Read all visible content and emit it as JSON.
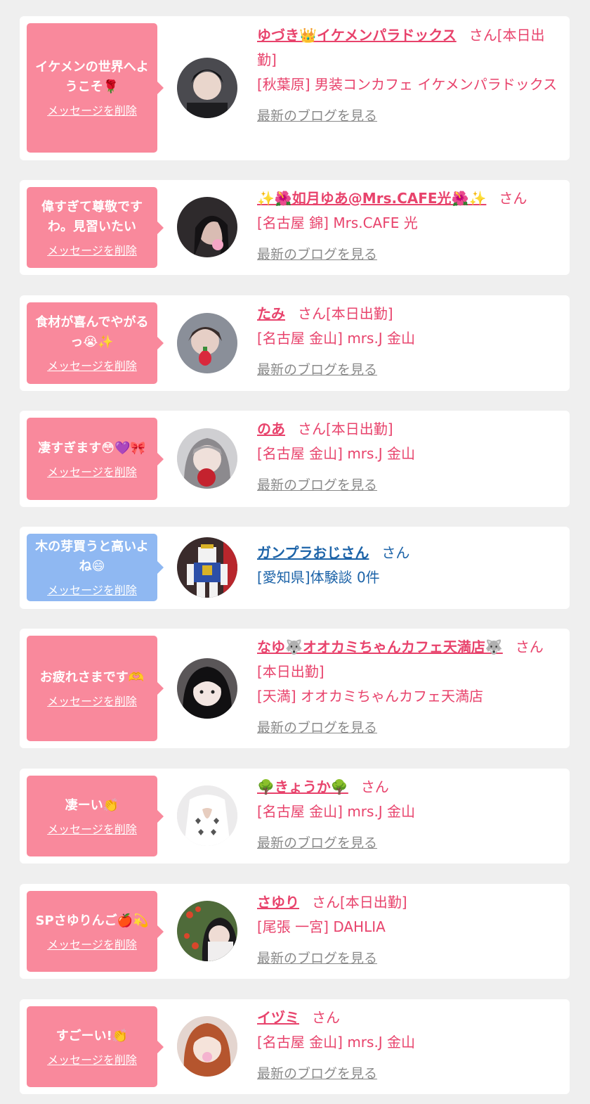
{
  "delete_label": "メッセージを削除",
  "blog_label": "最新のブログを見る",
  "san_label": "さん",
  "items": [
    {
      "message": "イケメンの世界へようこそ🌹",
      "name": "ゆづき👑イケメンパラドックス",
      "status": "[本日出勤]",
      "shop": "[秋葉原] 男装コンカフェ イケメンパラドックス",
      "theme": "pink",
      "avatar": "person-dark-hair"
    },
    {
      "message": "偉すぎて尊敬ですわ。見習いたい",
      "name": "✨🌺如月ゆあ@Mrs.CAFE光🌺✨",
      "status": "",
      "shop": "[名古屋 錦] Mrs.CAFE 光",
      "theme": "pink",
      "avatar": "person-dark"
    },
    {
      "message": "食材が喜んでやがるっ😭✨",
      "name": "たみ",
      "status": "[本日出勤]",
      "shop": "[名古屋 金山] mrs.J 金山",
      "theme": "pink",
      "avatar": "person-strawberry"
    },
    {
      "message": "凄すぎます😳💜🎀",
      "name": "のあ",
      "status": "[本日出勤]",
      "shop": "[名古屋 金山] mrs.J 金山",
      "theme": "pink",
      "avatar": "person-light-hair"
    },
    {
      "message": "木の芽買うと高いよね😄",
      "name": "ガンプラおじさん",
      "status": "",
      "shop": "[愛知県]体験談 0件",
      "theme": "blue",
      "avatar": "robot-model"
    },
    {
      "message": "お疲れさまです🫶",
      "name": "なゆ🐺オオカミちゃんカフェ天満店🐺",
      "status": "[本日出勤]",
      "shop": "[天満] オオカミちゃんカフェ天満店",
      "theme": "pink",
      "avatar": "person-bangs"
    },
    {
      "message": "凄ーい👏",
      "name": "🌳きょうか🌳",
      "status": "",
      "shop": "[名古屋 金山] mrs.J 金山",
      "theme": "pink",
      "avatar": "white-outfit"
    },
    {
      "message": "SPさゆりんご🍎💫",
      "name": "さゆり",
      "status": "[本日出勤]",
      "shop": "[尾張 一宮] DAHLIA",
      "theme": "pink",
      "avatar": "person-garden"
    },
    {
      "message": "すごーい!👏",
      "name": "イヅミ",
      "status": "",
      "shop": "[名古屋 金山] mrs.J 金山",
      "theme": "pink",
      "avatar": "person-auburn-hair"
    }
  ]
}
